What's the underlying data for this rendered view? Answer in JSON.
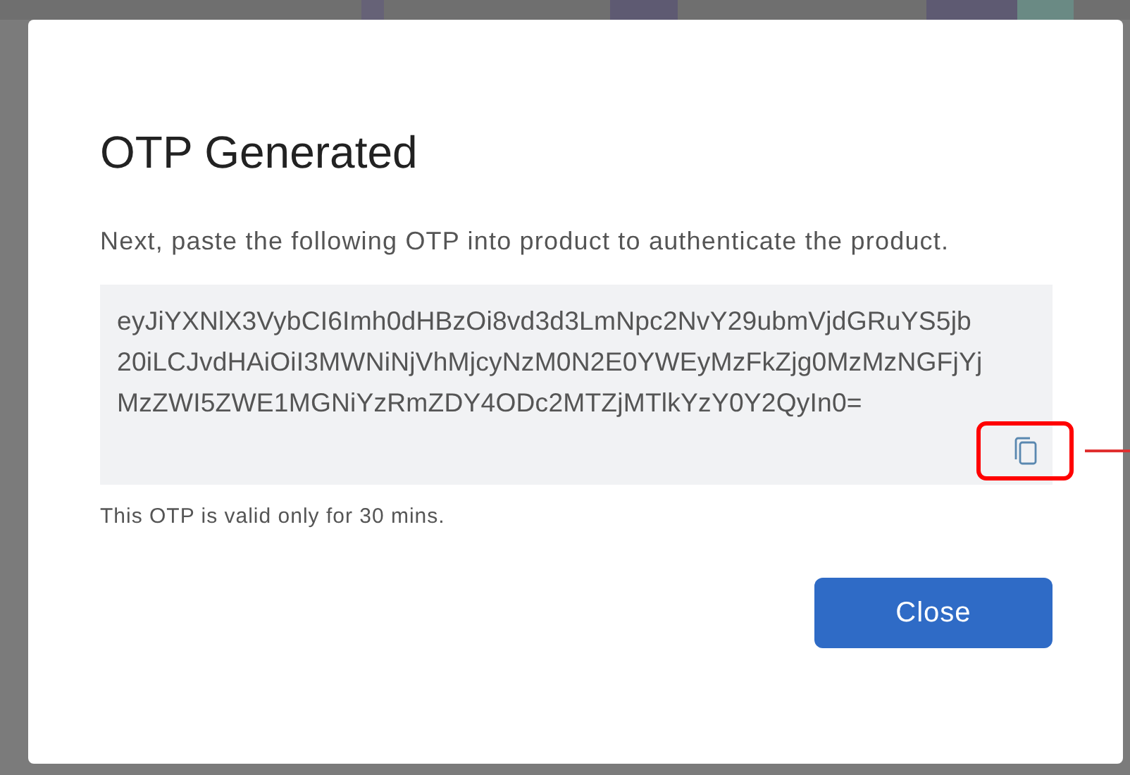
{
  "dialog": {
    "title": "OTP Generated",
    "message": "Next, paste the following OTP into product to authenticate the product.",
    "otp_lines": [
      "eyJiYXNlX3VybCI6Imh0dHBzOi8vd3d3LmNpc2NvY29ubmVjdGRuYS5jb",
      "20iLCJvdHAiOiI3MWNiNjVhMjcyNzM0N2E0YWEyMzFkZjg0MzMzNGFjYj",
      "MzZWI5ZWE1MGNiYzRmZDY4ODc2MTZjMTlkYzY0Y2QyIn0="
    ],
    "validity": "This OTP is valid only for 30 mins.",
    "buttons": [
      {
        "label": "Close",
        "kind": "primary"
      }
    ]
  }
}
